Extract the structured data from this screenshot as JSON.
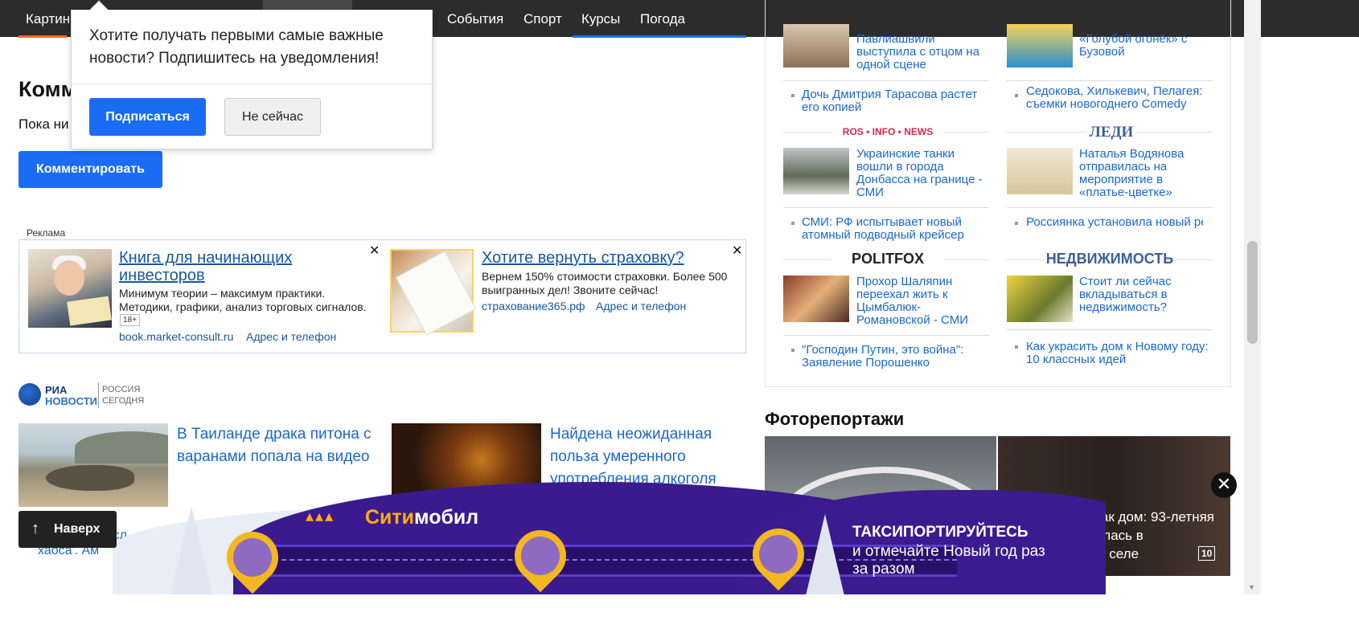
{
  "nav": {
    "items": [
      "Картин",
      "События",
      "Спорт",
      "Курсы",
      "Погода"
    ]
  },
  "popup": {
    "message": "Хотите получать первыми самые важные новости? Подпишитесь на уведомления!",
    "subscribe_label": "Подписаться",
    "later_label": "Не сейчас"
  },
  "comments": {
    "title": "Комм",
    "empty_text": "Пока ни",
    "button_label": "Комментировать"
  },
  "ads": {
    "label": "Реклама",
    "ad1": {
      "title": "Книга для начинающих инвесторов",
      "text": "Минимум теории – максимум практики. Методики, графики, анализ торговых сигналов.",
      "age": "18+",
      "domain": "book.market-consult.ru",
      "address": "Адрес и телефон",
      "close": "✕"
    },
    "ad2": {
      "title": "Хотите вернуть страховку?",
      "text": "Вернем 150% стоимости страховки. Более 500 выигранных дел! Звоните сейчас!",
      "domain": "страхование365.рф",
      "address": "Адрес и телефон",
      "close": "✕"
    }
  },
  "ria": {
    "logo_line1": "РИА",
    "logo_line2": "НОВОСТИ",
    "logo_side": "РОССИЯ СЕГОДНЯ",
    "news": [
      {
        "title": "В Таиланде драка питона с варанами попала на видео"
      },
      {
        "title": "Найдена неожиданная польза умеренного употребления алкоголя"
      }
    ],
    "sub_link": "\"…осталась сл… 'армию хаоса'. Ам"
  },
  "back_to_top": {
    "arrow": "↑",
    "label": "Наверх"
  },
  "right": {
    "top_left_title": "Павлиашвили выступила с отцом на одной сцене",
    "top_right_title": "«Голубой огонёк» с Бузовой",
    "link_l1": "Дочь Дмитрия Тарасова растет его копией",
    "link_r1": "Седокова, Хилькевич, Пелагея: съемки новогоднего Comedy",
    "brand_l2": "ROS • INFO • NEWS",
    "brand_r2": "ЛЕДИ",
    "title_l2": "Украинские танки вошли в города Донбасса на границе - СМИ",
    "title_r2": "Наталья Водянова отправилась на мероприятие в «платье-цветке»",
    "link_l2": "СМИ: РФ испытывает новый атомный подводный крейсер",
    "link_r2": "Россиянка установила новый рекорд по количеству стрижек",
    "brand_l3": "POLITFOX",
    "brand_r3": "НЕДВИЖИМОСТЬ",
    "title_l3": "Прохор Шаляпин переехал жить к Цымбалюк-Романовской - СМИ",
    "title_r3": "Стоит ли сейчас вкладываться в недвижимость?",
    "link_l3": "\"Господин Путин, это война\": Заявление Порошенко",
    "link_r3": "Как украсить дом к Новому году: 10 классных идей"
  },
  "photo": {
    "title": "Фоторепортажи",
    "caption": "Рассеялись, как дом: 93-летняя женщина осталась в опустошенном селе",
    "count": "10"
  },
  "banner": {
    "brand_dots": "▴▴▴",
    "brand_part1": "Сити",
    "brand_part2": "мобил",
    "slogan1": "ТАКСИПОРТИРУЙТЕСЬ",
    "slogan2": "и отмечайте Новый год раз за разом",
    "close": "✕"
  },
  "colors": {
    "accent": "#1a6cf4",
    "link": "#1967d2",
    "nav_bg": "#2c2c2c",
    "banner": "#3a1a8e",
    "banner_logo": "#ffad12"
  }
}
